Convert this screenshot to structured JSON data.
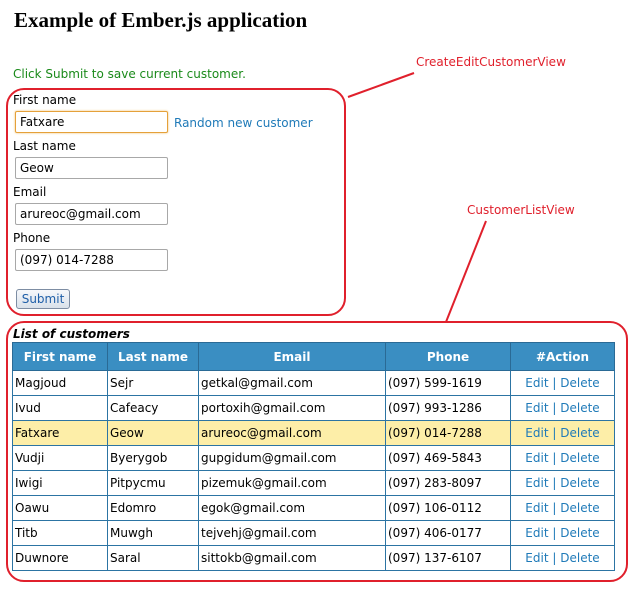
{
  "page": {
    "title": "Example of Ember.js application",
    "status_message": "Click Submit to save current customer."
  },
  "annotations": {
    "form_view": "CreateEditCustomerView",
    "list_view": "CustomerListView",
    "color": "#e0202c"
  },
  "form": {
    "first_name_label": "First name",
    "first_name_value": "Fatxare",
    "last_name_label": "Last name",
    "last_name_value": "Geow",
    "email_label": "Email",
    "email_value": "arureoc@gmail.com",
    "phone_label": "Phone",
    "phone_value": "(097) 014-7288",
    "random_link": "Random new customer",
    "submit_label": "Submit"
  },
  "list": {
    "caption": "List of customers",
    "columns": [
      "First name",
      "Last name",
      "Email",
      "Phone",
      "#Action"
    ],
    "edit_label": "Edit",
    "separator": "|",
    "delete_label": "Delete",
    "header_color": "#3a8ec2",
    "selected_row_color": "#fdeea8",
    "rows": [
      {
        "first": "Magjoud",
        "last": "Sejr",
        "email": "getkal@gmail.com",
        "phone": "(097) 599-1619",
        "selected": false
      },
      {
        "first": "Ivud",
        "last": "Cafeacy",
        "email": "portoxih@gmail.com",
        "phone": "(097) 993-1286",
        "selected": false
      },
      {
        "first": "Fatxare",
        "last": "Geow",
        "email": "arureoc@gmail.com",
        "phone": "(097) 014-7288",
        "selected": true
      },
      {
        "first": "Vudji",
        "last": "Byerygob",
        "email": "gupgidum@gmail.com",
        "phone": "(097) 469-5843",
        "selected": false
      },
      {
        "first": "Iwigi",
        "last": "Pitpycmu",
        "email": "pizemuk@gmail.com",
        "phone": "(097) 283-8097",
        "selected": false
      },
      {
        "first": "Oawu",
        "last": "Edomro",
        "email": "egok@gmail.com",
        "phone": "(097) 106-0112",
        "selected": false
      },
      {
        "first": "Titb",
        "last": "Muwgh",
        "email": "tejvehj@gmail.com",
        "phone": "(097) 406-0177",
        "selected": false
      },
      {
        "first": "Duwnore",
        "last": "Saral",
        "email": "sittokb@gmail.com",
        "phone": "(097) 137-6107",
        "selected": false
      }
    ]
  }
}
